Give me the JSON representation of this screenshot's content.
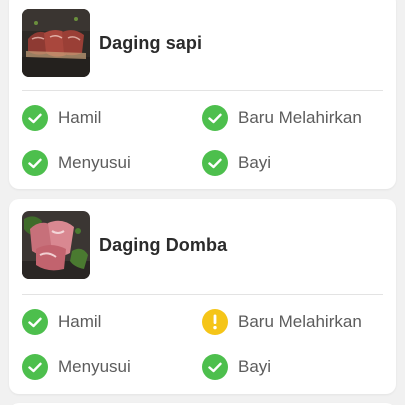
{
  "colors": {
    "ok": "#4dbf4d",
    "warning": "#f5c518"
  },
  "foods": [
    {
      "name": "Daging sapi",
      "image_icon": "beef-steak-image",
      "statuses": [
        {
          "label": "Hamil",
          "state": "ok",
          "icon": "check-circle-icon"
        },
        {
          "label": "Baru Melahirkan",
          "state": "ok",
          "icon": "check-circle-icon"
        },
        {
          "label": "Menyusui",
          "state": "ok",
          "icon": "check-circle-icon"
        },
        {
          "label": "Bayi",
          "state": "ok",
          "icon": "check-circle-icon"
        }
      ]
    },
    {
      "name": "Daging Domba",
      "image_icon": "lamb-meat-image",
      "statuses": [
        {
          "label": "Hamil",
          "state": "ok",
          "icon": "check-circle-icon"
        },
        {
          "label": "Baru Melahirkan",
          "state": "warning",
          "icon": "warning-circle-icon"
        },
        {
          "label": "Menyusui",
          "state": "ok",
          "icon": "check-circle-icon"
        },
        {
          "label": "Bayi",
          "state": "ok",
          "icon": "check-circle-icon"
        }
      ]
    }
  ]
}
